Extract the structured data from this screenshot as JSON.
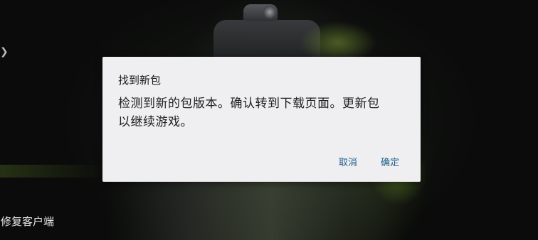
{
  "dialog": {
    "title": "找到新包",
    "message": "检测到新的包版本。确认转到下载页面。更新包\n以继续游戏。",
    "cancel_label": "取消",
    "confirm_label": "确定"
  },
  "background": {
    "repair_client_label": "修复客户端",
    "left_arrow_icon": "arrow-left-icon"
  },
  "colors": {
    "dialog_bg": "#efeff1",
    "button_text": "#1e5e8a"
  }
}
